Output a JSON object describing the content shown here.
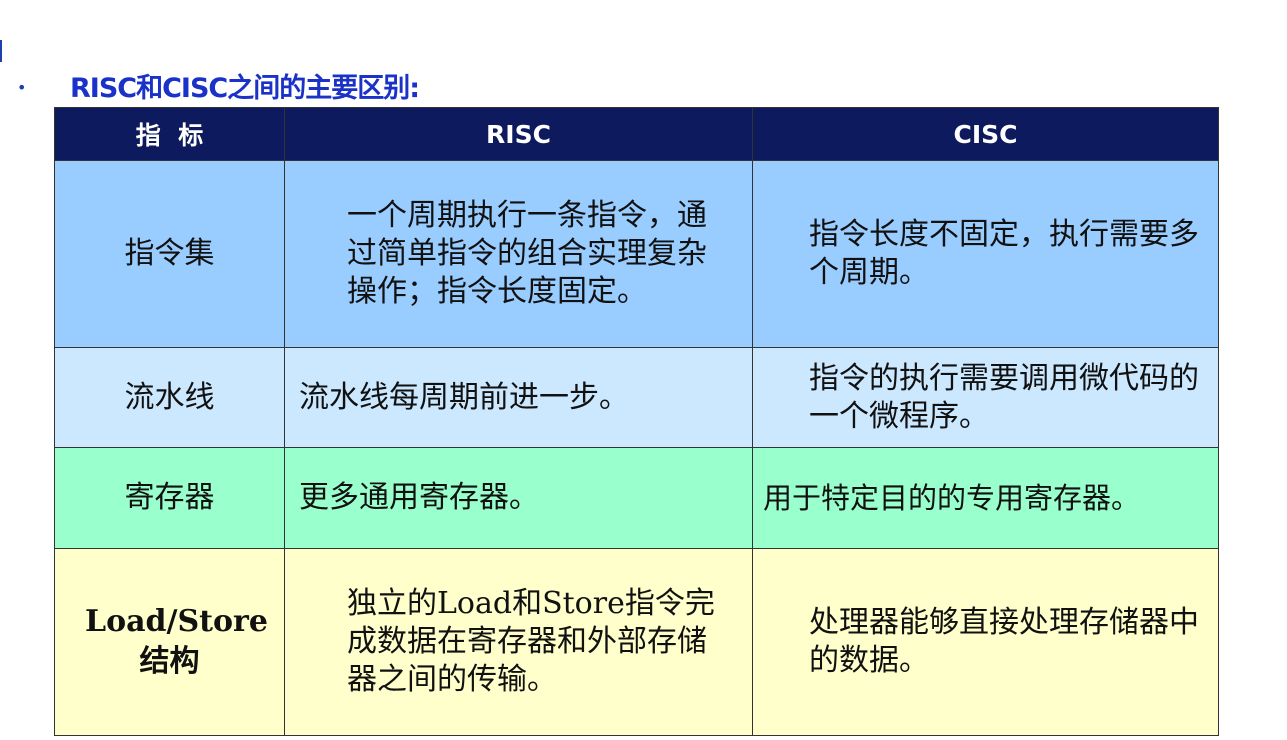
{
  "heading": "RISC和CISC之间的主要区别:",
  "bullet": "•",
  "table": {
    "headers": [
      "指  标",
      "RISC",
      "CISC"
    ],
    "rows": [
      {
        "label": "指令集",
        "risc": "一个周期执行一条指令，通过简单指令的组合实理复杂操作；指令长度固定。",
        "cisc": "指令长度不固定，执行需要多个周期。"
      },
      {
        "label": "流水线",
        "risc": "流水线每周期前进一步。",
        "cisc": "指令的执行需要调用微代码的一个微程序。"
      },
      {
        "label": "寄存器",
        "risc": "更多通用寄存器。",
        "cisc": "用于特定目的的专用寄存器。"
      },
      {
        "label": "Load/Store结构",
        "risc": "独立的Load和Store指令完成数据在寄存器和外部存储器之间的传输。",
        "cisc": "处理器能够直接处理存储器中的数据。"
      }
    ]
  },
  "colors": {
    "heading": "#1a32c8",
    "header_bg": "#0e1a5e",
    "row1": "#99ccff",
    "row2": "#cce8ff",
    "row3": "#99ffcc",
    "row4": "#ffffcc"
  }
}
